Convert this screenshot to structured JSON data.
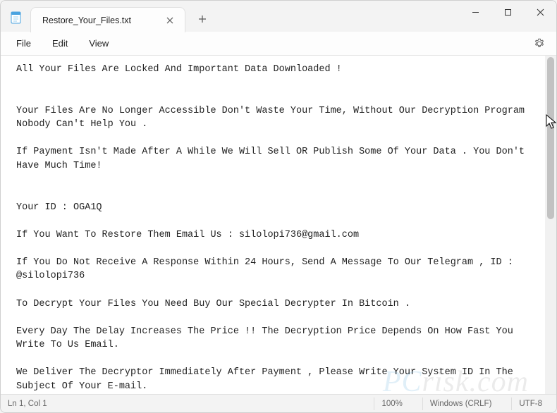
{
  "titlebar": {
    "tab_title": "Restore_Your_Files.txt"
  },
  "menubar": {
    "file": "File",
    "edit": "Edit",
    "view": "View"
  },
  "document": {
    "text": "All Your Files Are Locked And Important Data Downloaded !\n\n\nYour Files Are No Longer Accessible Don't Waste Your Time, Without Our Decryption Program Nobody Can't Help You .\n\nIf Payment Isn't Made After A While We Will Sell OR Publish Some Of Your Data . You Don't Have Much Time!\n\n\nYour ID : OGA1Q\n\nIf You Want To Restore Them Email Us : silolopi736@gmail.com\n\nIf You Do Not Receive A Response Within 24 Hours, Send A Message To Our Telegram , ID : @silolopi736\n\nTo Decrypt Your Files You Need Buy Our Special Decrypter In Bitcoin .\n\nEvery Day The Delay Increases The Price !! The Decryption Price Depends On How Fast You Write To Us Email.\n\nWe Deliver The Decryptor Immediately After Payment , Please Write Your System ID In The Subject Of Your E-mail.\n\n         s the guarantee !"
  },
  "statusbar": {
    "position": "Ln 1, Col 1",
    "zoom": "100%",
    "line_ending": "Windows (CRLF)",
    "encoding": "UTF-8"
  },
  "watermark": {
    "prefix": "PC",
    "suffix": "risk.com"
  }
}
